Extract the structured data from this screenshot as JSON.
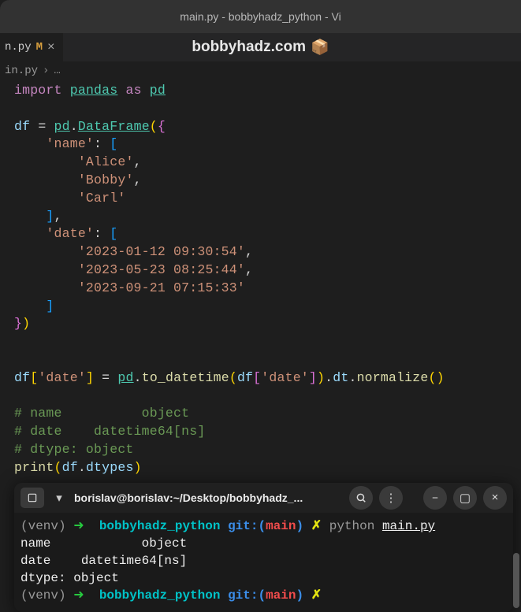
{
  "window": {
    "title": "main.py - bobbyhadz_python - Vi"
  },
  "watermark": {
    "text": "bobbyhadz.com",
    "icon": "📦"
  },
  "tab": {
    "filename": "n.py",
    "modified": "M",
    "close": "×"
  },
  "breadcrumb": {
    "file": "in.py",
    "sep": "›",
    "more": "…"
  },
  "terminal": {
    "header_title": "borislav@borislav:~/Desktop/bobbyhadz_...",
    "venv": "(venv)",
    "arrow": "➜",
    "dir": "bobbyhadz_python",
    "git_label": "git:(",
    "branch": "main",
    "git_close": ")",
    "dirty": "✗",
    "cmd_python": "python",
    "cmd_file": "main.py",
    "out1": "name            object",
    "out2": "date    datetime64[ns]",
    "out3": "dtype: object"
  }
}
